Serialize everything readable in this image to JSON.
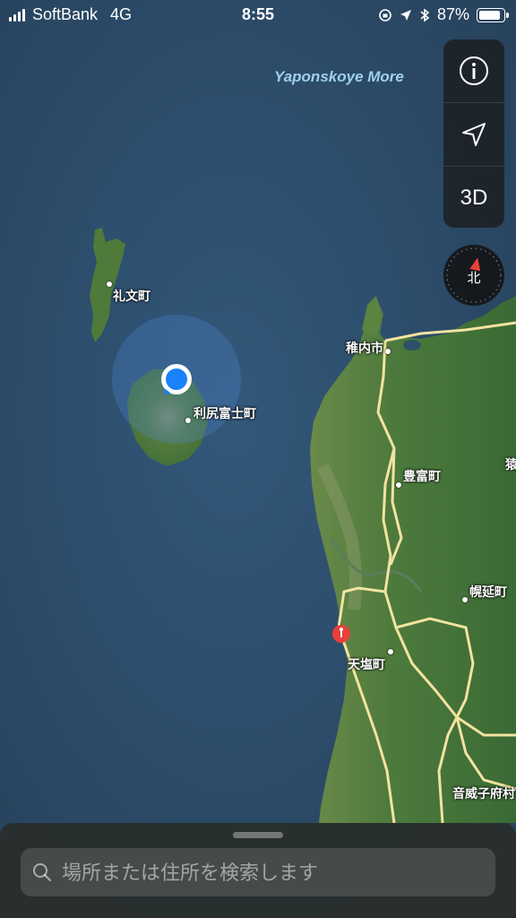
{
  "status_bar": {
    "carrier": "SoftBank",
    "network": "4G",
    "time": "8:55",
    "battery_percent": "87%",
    "battery_level": 0.87
  },
  "map": {
    "ocean_label": "Yaponskoye More",
    "places": {
      "rebun": "礼文町",
      "rishirifuji": "利尻富士町",
      "wakkanai": "稚内市",
      "toyotomi": "豊富町",
      "horonobe": "幌延町",
      "teshio": "天塩町",
      "otoineppu": "音威子府村",
      "edge": "猿"
    }
  },
  "controls": {
    "info_icon": "info-icon",
    "location_icon": "location-arrow-icon",
    "three_d_label": "3D",
    "compass_label": "北"
  },
  "search": {
    "placeholder": "場所または住所を検索します",
    "value": ""
  },
  "colors": {
    "ocean": "#2e4f6a",
    "land": "#4d7a3c",
    "user_location": "#1a82fb",
    "pin": "#e8403a",
    "road": "#f2e3a0"
  }
}
